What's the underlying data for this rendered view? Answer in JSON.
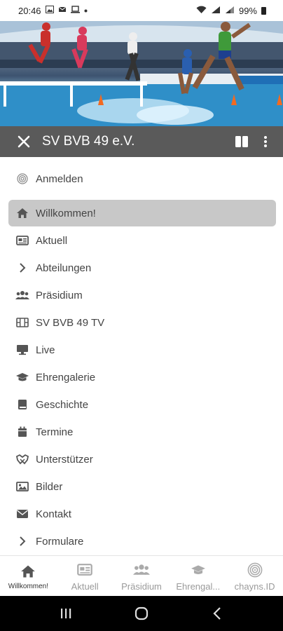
{
  "status_bar": {
    "time": "20:46",
    "battery": "99%"
  },
  "app_bar": {
    "title": "SV BVB 49 e.V."
  },
  "menu": {
    "login_label": "Anmelden",
    "items": [
      {
        "label": "Willkommen!",
        "icon": "home-icon",
        "active": true
      },
      {
        "label": "Aktuell",
        "icon": "news-icon"
      },
      {
        "label": "Abteilungen",
        "icon": "chevron-right-icon"
      },
      {
        "label": "Präsidium",
        "icon": "group-icon"
      },
      {
        "label": "SV BVB 49 TV",
        "icon": "film-icon"
      },
      {
        "label": "Live",
        "icon": "monitor-icon"
      },
      {
        "label": "Ehrengalerie",
        "icon": "graduation-cap-icon"
      },
      {
        "label": "Geschichte",
        "icon": "book-icon"
      },
      {
        "label": "Termine",
        "icon": "calendar-icon"
      },
      {
        "label": "Unterstützer",
        "icon": "handshake-icon"
      },
      {
        "label": "Bilder",
        "icon": "image-icon"
      },
      {
        "label": "Kontakt",
        "icon": "envelope-icon"
      },
      {
        "label": "Formulare",
        "icon": "chevron-right-icon"
      }
    ]
  },
  "tabs": [
    {
      "label": "Willkommen!",
      "icon": "home-icon",
      "active": true
    },
    {
      "label": "Aktuell",
      "icon": "news-icon"
    },
    {
      "label": "Präsidium",
      "icon": "group-icon"
    },
    {
      "label": "Ehrengal...",
      "icon": "graduation-cap-icon"
    },
    {
      "label": "chayns.ID",
      "icon": "fingerprint-icon"
    }
  ],
  "colors": {
    "app_bar": "#5a5a5a",
    "active_item": "#c8c8c8",
    "nav_bar": "#000000"
  }
}
